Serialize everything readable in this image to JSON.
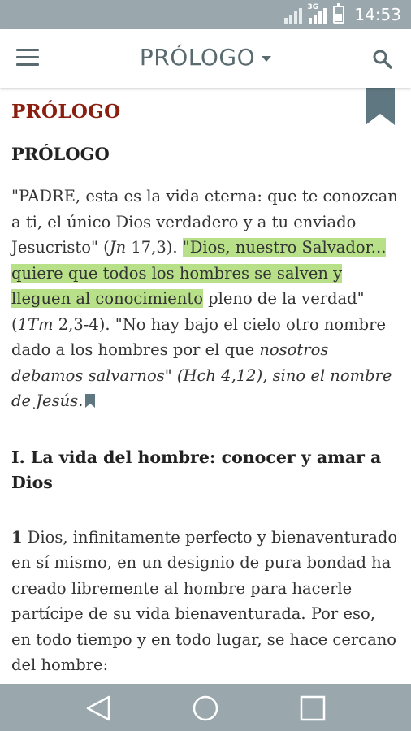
{
  "status_bar": {
    "network_type": "3G",
    "time": "14:53"
  },
  "app_bar": {
    "title": "PRÓLOGO",
    "icons": {
      "menu": "hamburger-menu-icon",
      "dropdown": "caret-down-icon",
      "search": "search-icon"
    }
  },
  "content": {
    "section_title": "PRÓLOGO",
    "subtitle": "PRÓLOGO",
    "paragraph1": {
      "before_ref1": "\"PADRE, esta es la vida eterna: que te conozcan a ti, el único Dios verdadero y a tu enviado Jesucristo\" (",
      "ref1_italic": "Jn",
      "ref1_rest": " 17,3). ",
      "highlighted": "\"Dios, nuestro Salvador... quiere que todos los hombres se salven y lleguen al conocimiento",
      "after_highlight": " pleno de la verdad\" (",
      "ref2_italic": "1Tm",
      "ref2_rest": " 2,3-4). \"No hay bajo el cielo otro nombre dado a los hombres por el que ",
      "italic_tail": "nosotros debamos salvarnos\" (Hch 4,12), sino el nombre de Jesús.",
      "highlight_color": "#b7e089"
    },
    "heading": "I. La vida del hombre: conocer y amar a Dios",
    "paragraph2": {
      "number": "1",
      "text": " Dios, infinitamente perfecto y bienaventurado en sí mismo, en un designio de pura bondad ha creado libremente al hombre para hacerle partícipe de su vida bienaventurada. Por eso, en todo tiempo y en todo lugar, se hace cercano del hombre:"
    }
  },
  "colors": {
    "status_bar": "#9aa8ad",
    "app_accent": "#5a6b70",
    "section_title": "#8a1f10",
    "bookmark": "#5f7780"
  },
  "nav_bar": {
    "icons": [
      "back-triangle-icon",
      "home-circle-icon",
      "recents-square-icon"
    ]
  }
}
